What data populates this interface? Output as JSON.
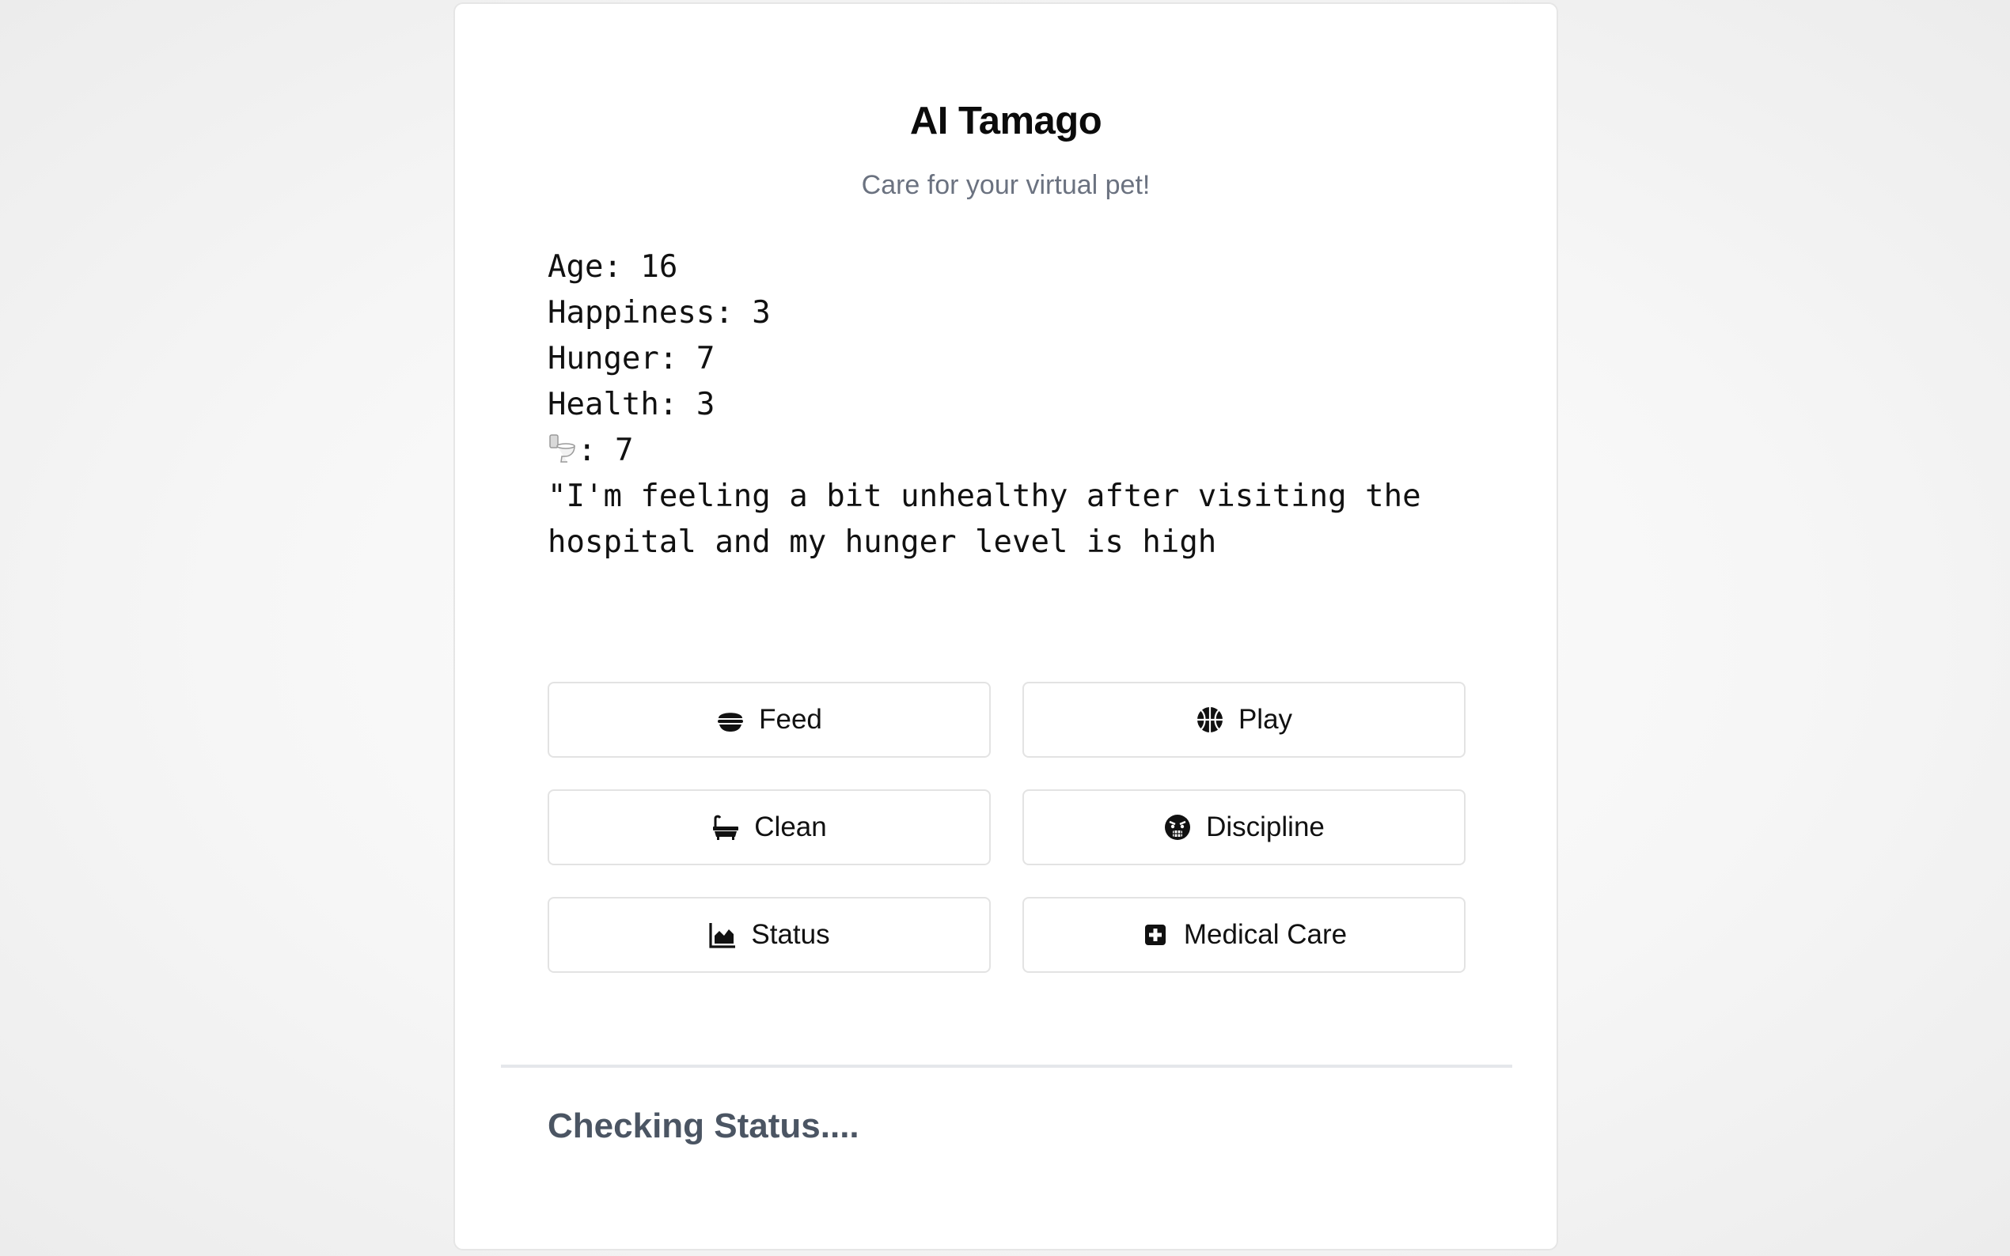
{
  "header": {
    "title": "AI Tamago",
    "subtitle": "Care for your virtual pet!"
  },
  "stats": {
    "age": "Age: 16",
    "happiness": "Happiness: 3",
    "hunger": "Hunger: 7",
    "health": "Health: 3",
    "toilet_icon": "toilet-icon",
    "toilet": ": 7",
    "message": "\"I'm feeling a bit unhealthy after visiting the hospital and my hunger level is high"
  },
  "actions": {
    "feed": {
      "label": "Feed",
      "icon": "food-bowl-icon"
    },
    "play": {
      "label": "Play",
      "icon": "basketball-icon"
    },
    "clean": {
      "label": "Clean",
      "icon": "bathtub-icon"
    },
    "discipline": {
      "label": "Discipline",
      "icon": "angry-face-icon"
    },
    "status": {
      "label": "Status",
      "icon": "area-chart-icon"
    },
    "medical": {
      "label": "Medical Care",
      "icon": "medical-plus-icon"
    }
  },
  "footer": {
    "status_text": "Checking Status...."
  }
}
